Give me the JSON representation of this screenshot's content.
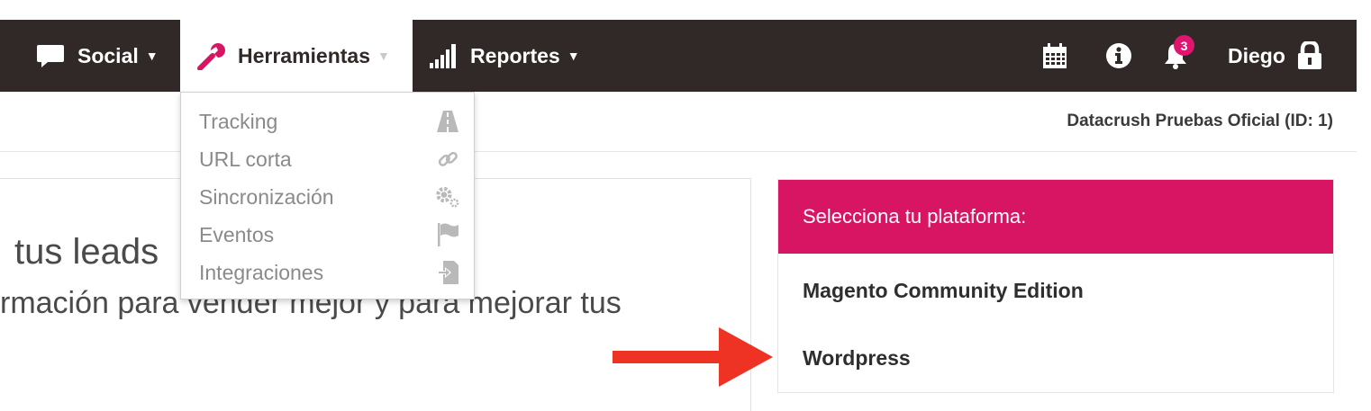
{
  "navbar": {
    "items": [
      {
        "label": "Social",
        "icon": "comment-icon"
      },
      {
        "label": "Herramientas",
        "icon": "wrench-icon",
        "active": true
      },
      {
        "label": "Reportes",
        "icon": "bar-chart-icon"
      }
    ],
    "right": {
      "calendar_icon": "calendar-icon",
      "info_icon": "info-icon",
      "notifications_count": "3",
      "user_name": "Diego",
      "lock_icon": "lock-icon"
    }
  },
  "dropdown": {
    "items": [
      {
        "label": "Tracking",
        "icon": "road-icon"
      },
      {
        "label": "URL corta",
        "icon": "link-icon"
      },
      {
        "label": "Sincronización",
        "icon": "cogs-icon"
      },
      {
        "label": "Eventos",
        "icon": "flag-icon"
      },
      {
        "label": "Integraciones",
        "icon": "sign-in-icon"
      }
    ]
  },
  "account": {
    "label": "Datacrush Pruebas Oficial (ID: 1)"
  },
  "hero": {
    "title": "tus leads",
    "subtitle": "rmación para vender mejor y para mejorar tus"
  },
  "platform_panel": {
    "header": "Selecciona tu plataforma:",
    "options": [
      "Magento Community Edition",
      "Wordpress"
    ]
  },
  "colors": {
    "navbar": "#302927",
    "accent": "#d81563",
    "badge": "#e0156f",
    "arrow": "#ee3224"
  }
}
